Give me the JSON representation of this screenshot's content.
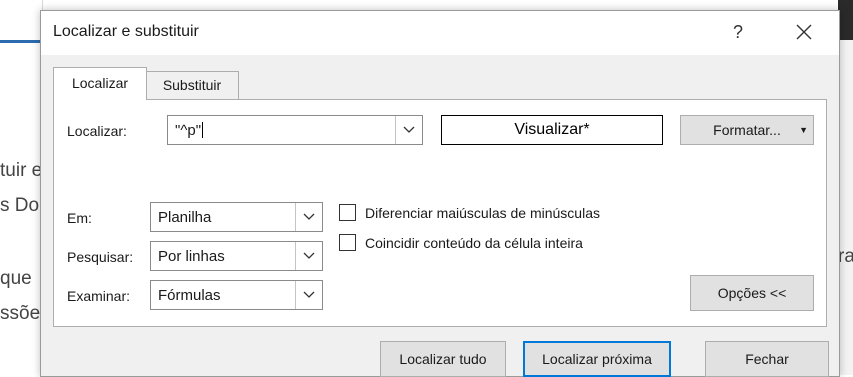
{
  "dialog": {
    "title": "Localizar e substituir",
    "help_label": "?"
  },
  "tabs": [
    {
      "label": "Localizar",
      "active": true
    },
    {
      "label": "Substituir",
      "active": false
    }
  ],
  "find": {
    "label": "Localizar:",
    "value": "\"^p\"",
    "preview_label": "Visualizar*",
    "format_label": "Formatar..."
  },
  "options": {
    "within": {
      "label": "Em:",
      "value": "Planilha"
    },
    "search": {
      "label": "Pesquisar:",
      "value": "Por linhas"
    },
    "look_in": {
      "label": "Examinar:",
      "value": "Fórmulas"
    },
    "match_case": {
      "label": "Diferenciar maiúsculas de minúsculas",
      "checked": false
    },
    "match_entire": {
      "label": "Coincidir conteúdo da célula inteira",
      "checked": false
    },
    "options_toggle_label": "Opções <<"
  },
  "buttons": {
    "find_all": "Localizar tudo",
    "find_next": "Localizar próxima",
    "close": "Fechar"
  },
  "background": {
    "left_lines": [
      "tuir e",
      "s Do",
      "que",
      "ssõe"
    ],
    "right_line": "ra"
  },
  "colors": {
    "accent": "#0078d7",
    "dialog_bg": "#f0f0f0",
    "panel_bg": "#ffffff",
    "button_bg": "#e1e1e1"
  }
}
